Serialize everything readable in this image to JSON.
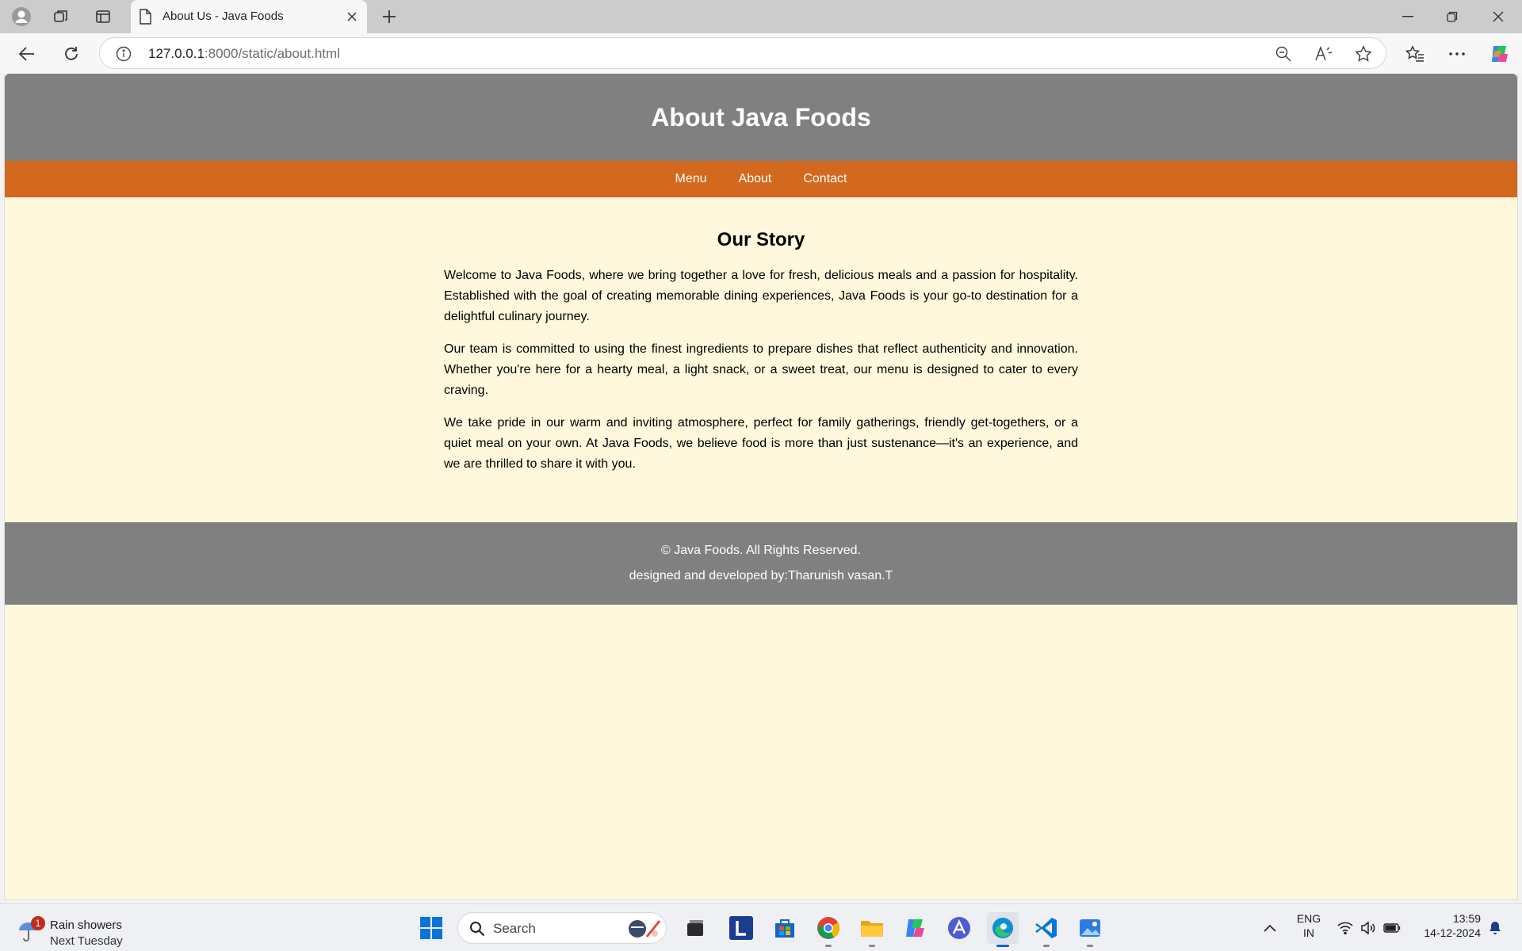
{
  "browser": {
    "tab": {
      "title": "About Us - Java Foods"
    },
    "address": {
      "host": "127.0.0.1",
      "rest": ":8000/static/about.html"
    }
  },
  "page": {
    "header_title": "About Java Foods",
    "nav": {
      "menu": "Menu",
      "about": "About",
      "contact": "Contact"
    },
    "section_title": "Our Story",
    "paragraphs": [
      "Welcome to Java Foods, where we bring together a love for fresh, delicious meals and a passion for hospitality. Established with the goal of creating memorable dining experiences, Java Foods is your go-to destination for a delightful culinary journey.",
      "Our team is committed to using the finest ingredients to prepare dishes that reflect authenticity and innovation. Whether you're here for a hearty meal, a light snack, or a sweet treat, our menu is designed to cater to every craving.",
      "We take pride in our warm and inviting atmosphere, perfect for family gatherings, friendly get-togethers, or a quiet meal on your own. At Java Foods, we believe food is more than just sustenance—it's an experience, and we are thrilled to share it with you."
    ],
    "footer": {
      "copyright": "© Java Foods. All Rights Reserved.",
      "credit": "designed and developed by:Tharunish vasan.T"
    }
  },
  "taskbar": {
    "weather": {
      "title": "Rain showers",
      "subtitle": "Next Tuesday",
      "badge": "1"
    },
    "search_placeholder": "Search",
    "lang": {
      "line1": "ENG",
      "line2": "IN"
    },
    "clock": {
      "time": "13:59",
      "date": "14-12-2024"
    }
  },
  "colors": {
    "header_bg": "#808080",
    "nav_bg": "#d2691e",
    "page_bg": "#fff8dc",
    "footer_bg": "#808080"
  }
}
